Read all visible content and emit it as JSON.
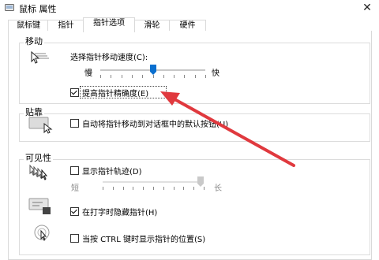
{
  "window": {
    "title": "鼠标 属性"
  },
  "tabs": [
    {
      "label": "鼠标键"
    },
    {
      "label": "指针"
    },
    {
      "label": "指针选项"
    },
    {
      "label": "滑轮"
    },
    {
      "label": "硬件"
    }
  ],
  "active_tab": "指针选项",
  "motion": {
    "heading": "移动",
    "speed_label": "选择指针移动速度(C):",
    "slow_label": "慢",
    "fast_label": "快",
    "speed_level": 0.5,
    "precision_label": "提高指针精确度(E)",
    "precision_checked": true
  },
  "snap": {
    "heading": "贴靠",
    "snap_label": "自动将指针移动到对话框中的默认按钮(U)",
    "snap_checked": false
  },
  "visibility": {
    "heading": "可见性",
    "trails_label": "显示指针轨迹(D)",
    "trails_checked": false,
    "short_label": "短",
    "long_label": "长",
    "trails_level": 1.0,
    "hide_label": "在打字时隐藏指针(H)",
    "hide_checked": true,
    "ctrl_label": "当按 CTRL 键时显示指针的位置(S)",
    "ctrl_checked": false
  },
  "colors": {
    "annotation_arrow": "#e0393e",
    "slider_thumb": "#0a6fcf"
  }
}
